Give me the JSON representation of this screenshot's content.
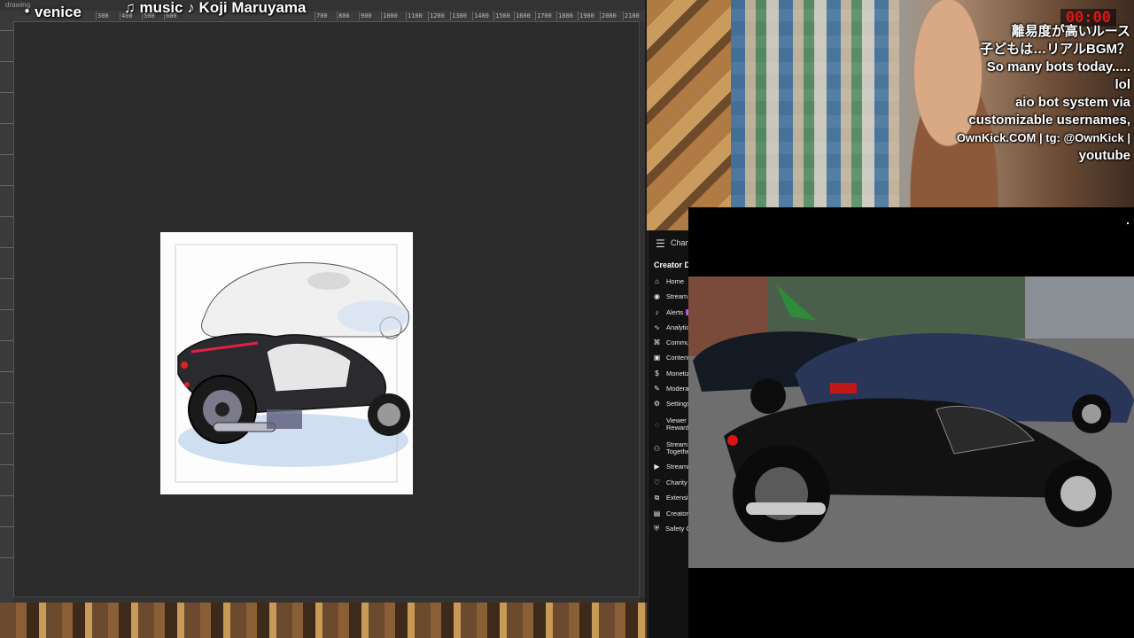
{
  "drawing_app": {
    "tab_label": "drawing",
    "overlay_title": "・venice",
    "overlay_music": "♫ music ♪ Koji Maruyama",
    "ruler_labels": [
      "300",
      "400",
      "500",
      "600",
      "700",
      "800",
      "900",
      "1000",
      "1100",
      "1200",
      "1300",
      "1400",
      "1500",
      "1600",
      "1700",
      "1800",
      "1900",
      "2000",
      "2100"
    ]
  },
  "webcam": {
    "timer": "00:00",
    "chat_lines": [
      "離易度が高いルース",
      "子どもは…リアルBGM？",
      "So many bots today.....",
      "lol",
      "aio bot system via",
      "customizable usernames,",
      "OwnKick.COM | tg: @OwnKick |",
      "youtube"
    ]
  },
  "dashboard": {
    "channel_label": "Channel",
    "heading": "Creator Dashboard",
    "nav": [
      {
        "label": "Home",
        "icon": "home-icon"
      },
      {
        "label": "Stream",
        "icon": "broadcast-icon"
      },
      {
        "label": "Alerts",
        "icon": "bell-icon"
      },
      {
        "label": "Analytics",
        "icon": "chart-icon"
      },
      {
        "label": "Community",
        "icon": "community-icon"
      },
      {
        "label": "Content",
        "icon": "content-icon"
      },
      {
        "label": "Monetize",
        "icon": "money-icon"
      },
      {
        "label": "Moderation",
        "icon": "pen-icon"
      },
      {
        "label": "Settings",
        "icon": "gear-icon"
      },
      {
        "label": "Viewer Rewards",
        "icon": "reward-icon"
      },
      {
        "label": "Stream Together",
        "icon": "people-icon"
      },
      {
        "label": "Streaming",
        "icon": "video-icon"
      },
      {
        "label": "Charity",
        "icon": "charity-icon"
      },
      {
        "label": "Extensions",
        "icon": "extension-icon"
      },
      {
        "label": "Creator",
        "icon": "creator-icon"
      },
      {
        "label": "Safety Center",
        "icon": "shield-icon"
      }
    ]
  },
  "colors": {
    "timer": "#e01515",
    "alerts_badge": "#b455e6",
    "canvas_bg": "#2b2b2b"
  }
}
